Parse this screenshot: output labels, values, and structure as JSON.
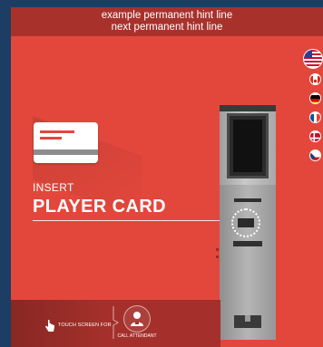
{
  "hint_bar": {
    "line1": "example permanent hint line",
    "line2": "next permanent hint line"
  },
  "prompt": {
    "line1": "INSERT",
    "line2": "PLAYER CARD"
  },
  "languages": [
    {
      "name": "flag-us-icon",
      "selected": true
    },
    {
      "name": "flag-ca-icon",
      "selected": false
    },
    {
      "name": "flag-de-icon",
      "selected": false
    },
    {
      "name": "flag-fr-icon",
      "selected": false
    },
    {
      "name": "flag-dk-icon",
      "selected": false
    },
    {
      "name": "flag-cz-icon",
      "selected": false
    }
  ],
  "bottom": {
    "touch_hint": "TOUCH SCREEN FOR",
    "call_label": "CALL ATTENDANT"
  },
  "colors": {
    "background": "#e3473c",
    "bar": "#a9312c",
    "frame": "#1c3d64"
  }
}
